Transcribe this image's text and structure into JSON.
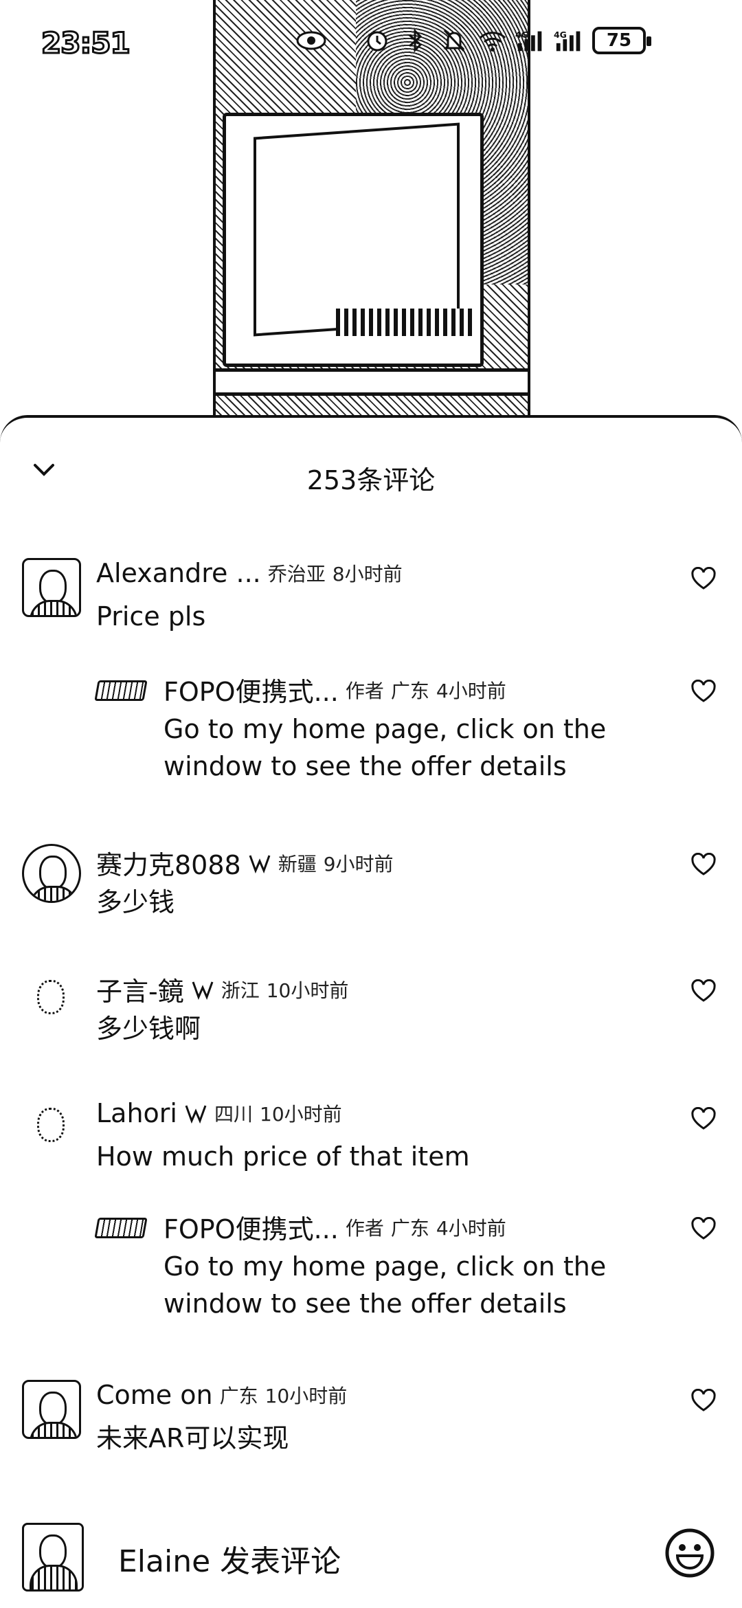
{
  "status_bar": {
    "time": "23:51",
    "battery": "75"
  },
  "sheet": {
    "title": "253条评论"
  },
  "comments": [
    {
      "name": "Alexandre ...",
      "location": "乔治亚",
      "time": "8小时前",
      "text": "Price pls",
      "replies": [
        {
          "name": "FOPO便携式...",
          "tag": "作者",
          "location": "广东",
          "time": "4小时前",
          "text": "Go to my home page, click on the window to see the offer details"
        }
      ]
    },
    {
      "name": "赛力克8088",
      "location": "新疆",
      "time": "9小时前",
      "text": "多少钱"
    },
    {
      "name": "子言-鏡",
      "location": "浙江",
      "time": "10小时前",
      "text": "多少钱啊"
    },
    {
      "name": "Lahori",
      "location": "四川",
      "time": "10小时前",
      "text": "How much price of that item",
      "replies": [
        {
          "name": "FOPO便携式...",
          "tag": "作者",
          "location": "广东",
          "time": "4小时前",
          "text": "Go to my home page, click on the window to see the offer details"
        }
      ]
    },
    {
      "name": "Come on",
      "location": "广东",
      "time": "10小时前",
      "text": "未来AR可以实现"
    }
  ],
  "input_bar": {
    "placeholder": "Elaine 发表评论"
  },
  "icons": {
    "collapse": "chevron-down-icon",
    "like": "heart-outline-icon",
    "verified": "verified-badge-icon",
    "emoji": "smiley-icon"
  }
}
